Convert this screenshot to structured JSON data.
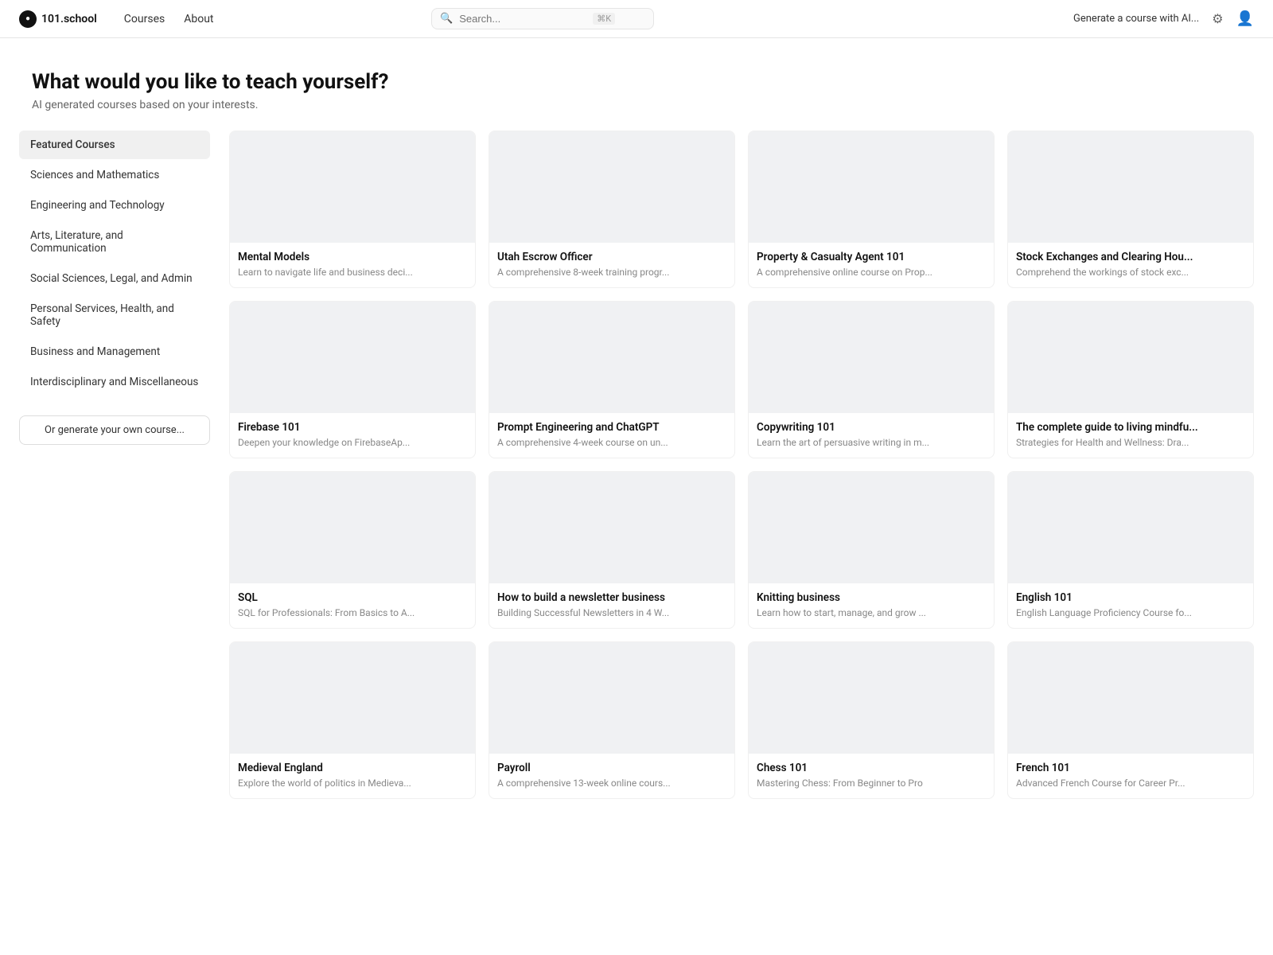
{
  "nav": {
    "logo_text": "101.school",
    "logo_icon": "●",
    "links": [
      "Courses",
      "About"
    ],
    "search_placeholder": "Search...",
    "search_shortcut": "⌘K",
    "generate_label": "Generate a course with AI...",
    "theme_icon": "⚙",
    "user_icon": "👤"
  },
  "hero": {
    "title": "What would you like to teach yourself?",
    "subtitle": "AI generated courses based on your interests."
  },
  "sidebar": {
    "items": [
      {
        "id": "featured",
        "label": "Featured Courses",
        "active": true
      },
      {
        "id": "sciences",
        "label": "Sciences and Mathematics"
      },
      {
        "id": "engineering",
        "label": "Engineering and Technology"
      },
      {
        "id": "arts",
        "label": "Arts, Literature, and Communication"
      },
      {
        "id": "social",
        "label": "Social Sciences, Legal, and Admin"
      },
      {
        "id": "personal",
        "label": "Personal Services, Health, and Safety"
      },
      {
        "id": "business",
        "label": "Business and Management"
      },
      {
        "id": "interdisciplinary",
        "label": "Interdisciplinary and Miscellaneous"
      }
    ],
    "generate_label": "Or generate your own course..."
  },
  "courses": [
    {
      "title": "Mental Models",
      "desc": "Learn to navigate life and business deci..."
    },
    {
      "title": "Utah Escrow Officer",
      "desc": "A comprehensive 8-week training progr..."
    },
    {
      "title": "Property & Casualty Agent 101",
      "desc": "A comprehensive online course on Prop..."
    },
    {
      "title": "Stock Exchanges and Clearing Hou...",
      "desc": "Comprehend the workings of stock exc..."
    },
    {
      "title": "Firebase 101",
      "desc": "Deepen your knowledge on FirebaseAp..."
    },
    {
      "title": "Prompt Engineering and ChatGPT",
      "desc": "A comprehensive 4-week course on un..."
    },
    {
      "title": "Copywriting 101",
      "desc": "Learn the art of persuasive writing in m..."
    },
    {
      "title": "The complete guide to living mindfu...",
      "desc": "Strategies for Health and Wellness: Dra..."
    },
    {
      "title": "SQL",
      "desc": "SQL for Professionals: From Basics to A..."
    },
    {
      "title": "How to build a newsletter business",
      "desc": "Building Successful Newsletters in 4 W..."
    },
    {
      "title": "Knitting business",
      "desc": "Learn how to start, manage, and grow ..."
    },
    {
      "title": "English 101",
      "desc": "English Language Proficiency Course fo..."
    },
    {
      "title": "Medieval England",
      "desc": "Explore the world of politics in Medieva..."
    },
    {
      "title": "Payroll",
      "desc": "A comprehensive 13-week online cours..."
    },
    {
      "title": "Chess 101",
      "desc": "Mastering Chess: From Beginner to Pro"
    },
    {
      "title": "French 101",
      "desc": "Advanced French Course for Career Pr..."
    }
  ]
}
